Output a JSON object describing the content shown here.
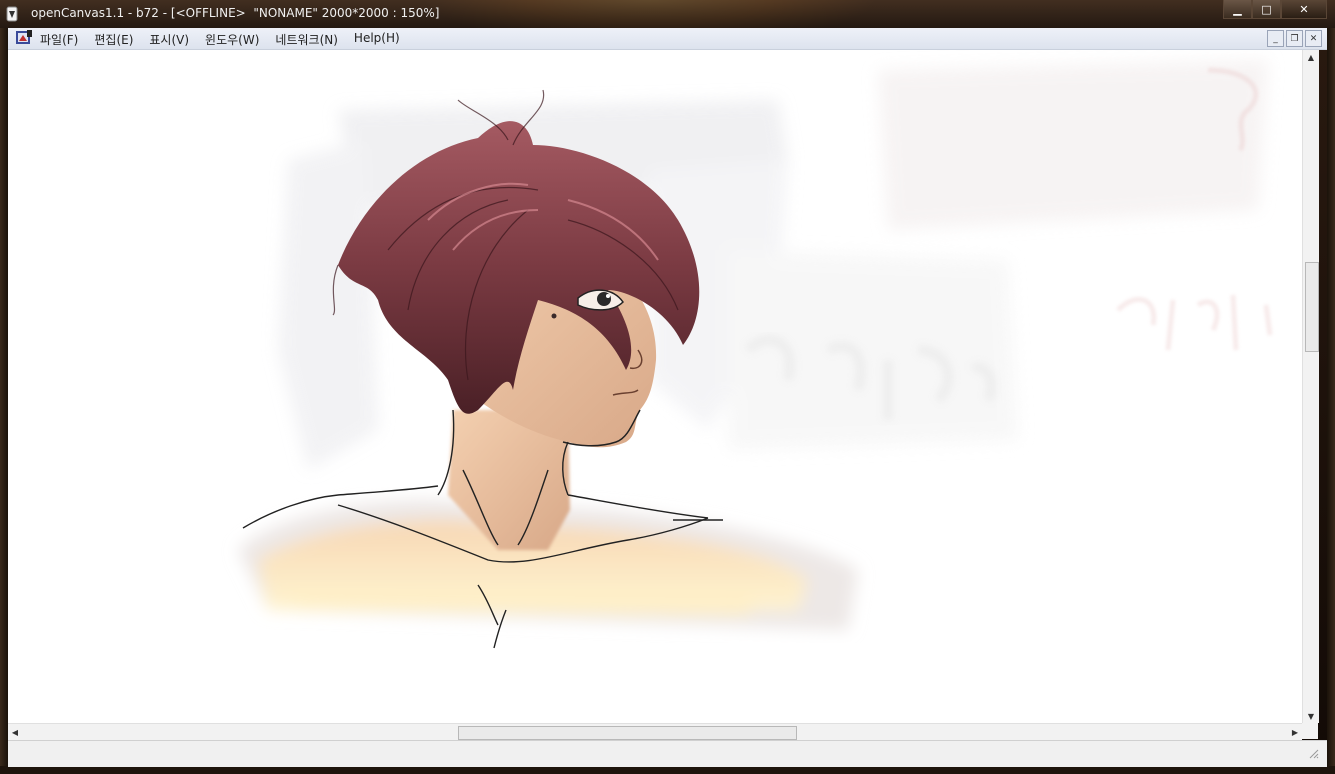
{
  "window": {
    "title": "openCanvas1.1 - b72 - [<OFFLINE>  \"NONAME\" 2000*2000 : 150%]",
    "controls": {
      "minimize": "▁",
      "maximize": "□",
      "close": "✕"
    }
  },
  "menubar": {
    "items": [
      {
        "label": "파일(F)"
      },
      {
        "label": "편집(E)"
      },
      {
        "label": "표시(V)"
      },
      {
        "label": "윈도우(W)"
      },
      {
        "label": "네트워크(N)"
      },
      {
        "label": "Help(H)"
      }
    ],
    "mdi_controls": {
      "minimize": "_",
      "restore": "❐",
      "close": "✕"
    }
  },
  "canvas": {
    "document_name": "NONAME",
    "size": "2000*2000",
    "zoom": "150%",
    "mode": "<OFFLINE>"
  },
  "scrollbars": {
    "up_arrow": "▲",
    "down_arrow": "▼",
    "left_arrow": "◀",
    "right_arrow": "▶"
  },
  "colors": {
    "canvas_bg": "#ffffff",
    "hair": "#7a3a42",
    "skin": "#efc7a6",
    "menubar": "#e6eaf2"
  }
}
